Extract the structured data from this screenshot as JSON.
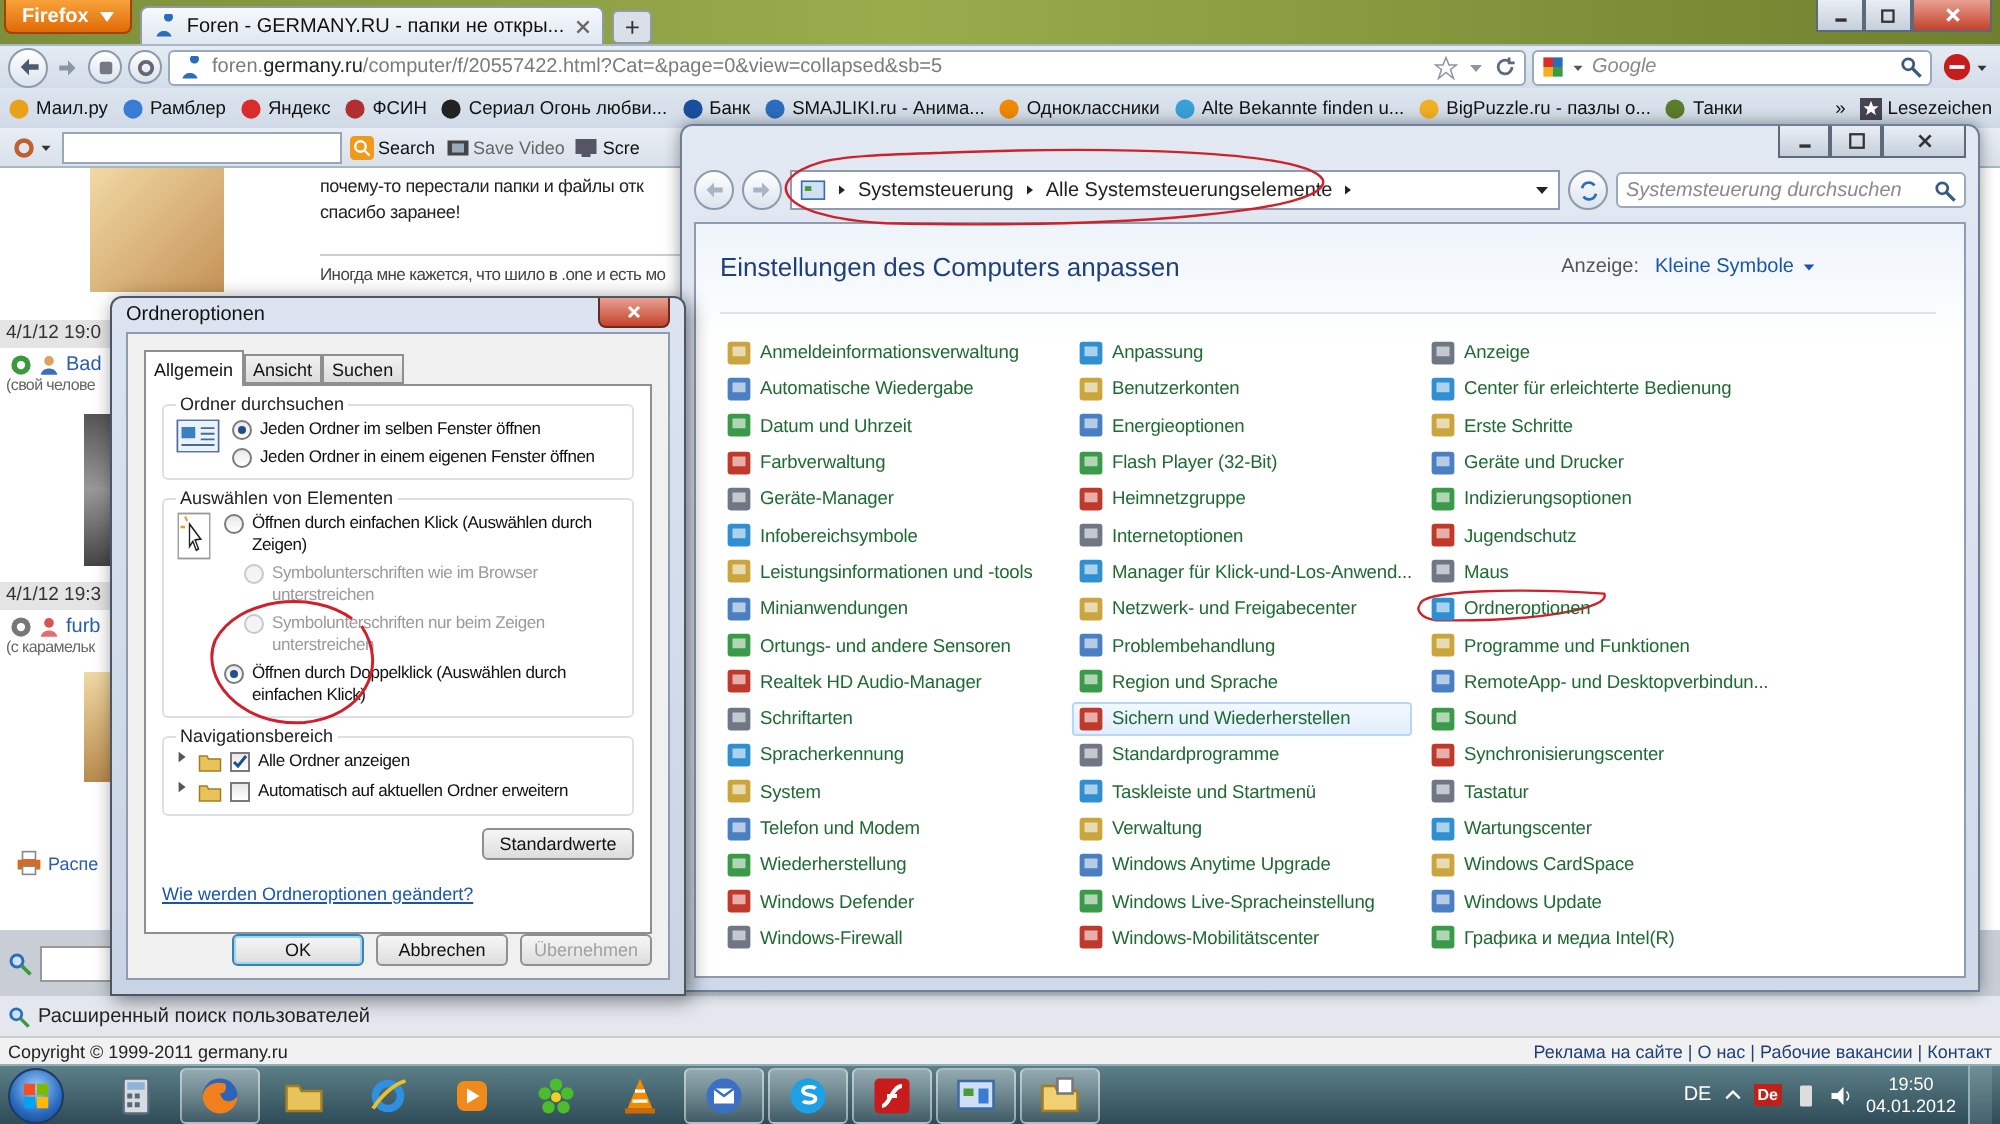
{
  "browser": {
    "menu_button": "Firefox",
    "tabs": [
      {
        "title": "Foren - GERMANY.RU - папки не откры...",
        "selected": true
      }
    ],
    "new_tab": "+",
    "url": "foren.**germany.ru**/computer/f/20557422.html?Cat=&page=0&view=collapsed&sb=5",
    "search": {
      "placeholder": "Google"
    },
    "bookmarks": [
      {
        "label": "Маил.ру"
      },
      {
        "label": "Рамблер"
      },
      {
        "label": "Яндекс"
      },
      {
        "label": "ФСИН"
      },
      {
        "label": "Сериал Огонь любви..."
      },
      {
        "label": "Банк"
      },
      {
        "label": "SMAJLIKI.ru - Анима..."
      },
      {
        "label": "Одноклассники"
      },
      {
        "label": "Alte Bekannte finden u..."
      },
      {
        "label": "BigPuzzle.ru - пазлы о..."
      },
      {
        "label": "Танки"
      }
    ],
    "bookmarks_more": "»",
    "bookmarks_menu": "Lesezeichen",
    "addon_buttons": [
      {
        "kind": "search",
        "label": "Search"
      },
      {
        "kind": "video",
        "label": "Save Video"
      },
      {
        "kind": "screen",
        "label": "Scre"
      }
    ],
    "page": {
      "post_lines": [
        "почему-то перестали папки и файлы отк",
        "спасибо заранее!"
      ],
      "quote_line": "Иногда мне кажется, что шило в .one и есть мо",
      "posts": [
        {
          "date": "4/1/12 19:0",
          "user": "Bad",
          "status": "(свой челове"
        },
        {
          "date": "4/1/12 19:3",
          "user": "furb",
          "status": "(с карамельк"
        }
      ],
      "print_link": "Распе",
      "user_search_link": "Расширенный поиск пользователей"
    },
    "footer": {
      "copyright": "Copyright © 1999-2011 germany.ru",
      "links": "Реклама на сайте | О нас | Рабочие вакансии | Контакт"
    }
  },
  "control_panel": {
    "breadcrumb": [
      "Systemsteuerung",
      "Alle Systemsteuerungselemente"
    ],
    "breadcrumb_annotated": true,
    "search": {
      "placeholder": "Systemsteuerung durchsuchen"
    },
    "heading": "Einstellungen des Computers anpassen",
    "view_label": "Anzeige:",
    "view_value": "Kleine Symbole",
    "columns": [
      [
        {
          "label": "Anmeldeinformationsverwaltung",
          "selected": false,
          "annotated": false
        },
        {
          "label": "Automatische Wiedergabe",
          "selected": false,
          "annotated": false
        },
        {
          "label": "Datum und Uhrzeit",
          "selected": false,
          "annotated": false
        },
        {
          "label": "Farbverwaltung",
          "selected": false,
          "annotated": false
        },
        {
          "label": "Geräte-Manager",
          "selected": false,
          "annotated": false
        },
        {
          "label": "Infobereichsymbole",
          "selected": false,
          "annotated": false
        },
        {
          "label": "Leistungsinformationen und -tools",
          "selected": false,
          "annotated": false
        },
        {
          "label": "Minianwendungen",
          "selected": false,
          "annotated": false
        },
        {
          "label": "Ortungs- und andere Sensoren",
          "selected": false,
          "annotated": false
        },
        {
          "label": "Realtek HD Audio-Manager",
          "selected": false,
          "annotated": false
        },
        {
          "label": "Schriftarten",
          "selected": false,
          "annotated": false
        },
        {
          "label": "Spracherkennung",
          "selected": false,
          "annotated": false
        },
        {
          "label": "System",
          "selected": false,
          "annotated": false
        },
        {
          "label": "Telefon und Modem",
          "selected": false,
          "annotated": false
        },
        {
          "label": "Wiederherstellung",
          "selected": false,
          "annotated": false
        },
        {
          "label": "Windows Defender",
          "selected": false,
          "annotated": false
        },
        {
          "label": "Windows-Firewall",
          "selected": false,
          "annotated": false
        }
      ],
      [
        {
          "label": "Anpassung",
          "selected": false,
          "annotated": false
        },
        {
          "label": "Benutzerkonten",
          "selected": false,
          "annotated": false
        },
        {
          "label": "Energieoptionen",
          "selected": false,
          "annotated": false
        },
        {
          "label": "Flash Player (32-Bit)",
          "selected": false,
          "annotated": false
        },
        {
          "label": "Heimnetzgruppe",
          "selected": false,
          "annotated": false
        },
        {
          "label": "Internetoptionen",
          "selected": false,
          "annotated": false
        },
        {
          "label": "Manager für Klick-und-Los-Anwend...",
          "selected": false,
          "annotated": false
        },
        {
          "label": "Netzwerk- und Freigabecenter",
          "selected": false,
          "annotated": false
        },
        {
          "label": "Problembehandlung",
          "selected": false,
          "annotated": false
        },
        {
          "label": "Region und Sprache",
          "selected": false,
          "annotated": false
        },
        {
          "label": "Sichern und Wiederherstellen",
          "selected": true,
          "annotated": false
        },
        {
          "label": "Standardprogramme",
          "selected": false,
          "annotated": false
        },
        {
          "label": "Taskleiste und Startmenü",
          "selected": false,
          "annotated": false
        },
        {
          "label": "Verwaltung",
          "selected": false,
          "annotated": false
        },
        {
          "label": "Windows Anytime Upgrade",
          "selected": false,
          "annotated": false
        },
        {
          "label": "Windows Live-Spracheinstellung",
          "selected": false,
          "annotated": false
        },
        {
          "label": "Windows-Mobilitätscenter",
          "selected": false,
          "annotated": false
        }
      ],
      [
        {
          "label": "Anzeige",
          "selected": false,
          "annotated": false
        },
        {
          "label": "Center für erleichterte Bedienung",
          "selected": false,
          "annotated": false
        },
        {
          "label": "Erste Schritte",
          "selected": false,
          "annotated": false
        },
        {
          "label": "Geräte und Drucker",
          "selected": false,
          "annotated": false
        },
        {
          "label": "Indizierungsoptionen",
          "selected": false,
          "annotated": false
        },
        {
          "label": "Jugendschutz",
          "selected": false,
          "annotated": false
        },
        {
          "label": "Maus",
          "selected": false,
          "annotated": false
        },
        {
          "label": "Ordneroptionen",
          "selected": false,
          "annotated": true
        },
        {
          "label": "Programme und Funktionen",
          "selected": false,
          "annotated": false
        },
        {
          "label": "RemoteApp- und Desktopverbindun...",
          "selected": false,
          "annotated": false
        },
        {
          "label": "Sound",
          "selected": false,
          "annotated": false
        },
        {
          "label": "Synchronisierungscenter",
          "selected": false,
          "annotated": false
        },
        {
          "label": "Tastatur",
          "selected": false,
          "annotated": false
        },
        {
          "label": "Wartungscenter",
          "selected": false,
          "annotated": false
        },
        {
          "label": "Windows CardSpace",
          "selected": false,
          "annotated": false
        },
        {
          "label": "Windows Update",
          "selected": false,
          "annotated": false
        },
        {
          "label": "Графика и медиа Intel(R)",
          "selected": false,
          "annotated": false
        }
      ]
    ]
  },
  "dialog": {
    "title": "Ordneroptionen",
    "tabs": [
      {
        "label": "Allgemein",
        "selected": true
      },
      {
        "label": "Ansicht",
        "selected": false
      },
      {
        "label": "Suchen",
        "selected": false
      }
    ],
    "groups": [
      {
        "kind": "browse",
        "title": "Ordner durchsuchen",
        "options": [
          {
            "kind": "radio",
            "label": "Jeden Ordner im selben Fenster öffnen",
            "selected": true,
            "disabled": false,
            "annotated": false
          },
          {
            "kind": "radio",
            "label": "Jeden Ordner in einem eigenen Fenster öffnen",
            "selected": false,
            "disabled": false,
            "annotated": false
          }
        ]
      },
      {
        "kind": "click",
        "title": "Auswählen von Elementen",
        "options": [
          {
            "kind": "radio",
            "label": "Öffnen durch einfachen Klick (Auswählen durch Zeigen)",
            "selected": false,
            "disabled": false,
            "annotated": false,
            "children": [
              {
                "kind": "radio",
                "label": "Symbolunterschriften wie im Browser unterstreichen",
                "selected": false,
                "disabled": true,
                "annotated": false
              },
              {
                "kind": "radio",
                "label": "Symbolunterschriften nur beim Zeigen unterstreichen",
                "selected": false,
                "disabled": true,
                "annotated": false
              }
            ]
          },
          {
            "kind": "radio",
            "label": "Öffnen durch Doppelklick (Auswählen durch einfachen Klick)",
            "selected": true,
            "disabled": false,
            "annotated": true
          }
        ]
      },
      {
        "kind": "navigation",
        "title": "Navigationsbereich",
        "options": [
          {
            "kind": "checkbox",
            "label": "Alle Ordner anzeigen",
            "checked": true
          },
          {
            "kind": "checkbox",
            "label": "Automatisch auf aktuellen Ordner erweitern",
            "checked": false
          }
        ]
      }
    ],
    "defaults_button": "Standardwerte",
    "help_link": "Wie werden Ordneroptionen geändert?",
    "buttons": [
      {
        "label": "OK",
        "default": true,
        "disabled": false
      },
      {
        "label": "Abbrechen",
        "default": false,
        "disabled": false
      },
      {
        "label": "Übernehmen",
        "default": false,
        "disabled": true
      }
    ]
  },
  "taskbar": {
    "apps": [
      {
        "kind": "calculator",
        "running": false
      },
      {
        "kind": "firefox",
        "running": true
      },
      {
        "kind": "explorer",
        "running": false
      },
      {
        "kind": "ie",
        "running": false
      },
      {
        "kind": "media",
        "running": false
      },
      {
        "kind": "icq",
        "running": false
      },
      {
        "kind": "vlc",
        "running": false
      },
      {
        "kind": "thunderbird",
        "running": true
      },
      {
        "kind": "skype",
        "running": true
      },
      {
        "kind": "flash",
        "running": true
      },
      {
        "kind": "controlpanel",
        "running": true
      },
      {
        "kind": "folder",
        "running": true
      }
    ],
    "language": "DE",
    "tray_badge": "De",
    "time": "19:50",
    "date": "04.01.2012"
  }
}
